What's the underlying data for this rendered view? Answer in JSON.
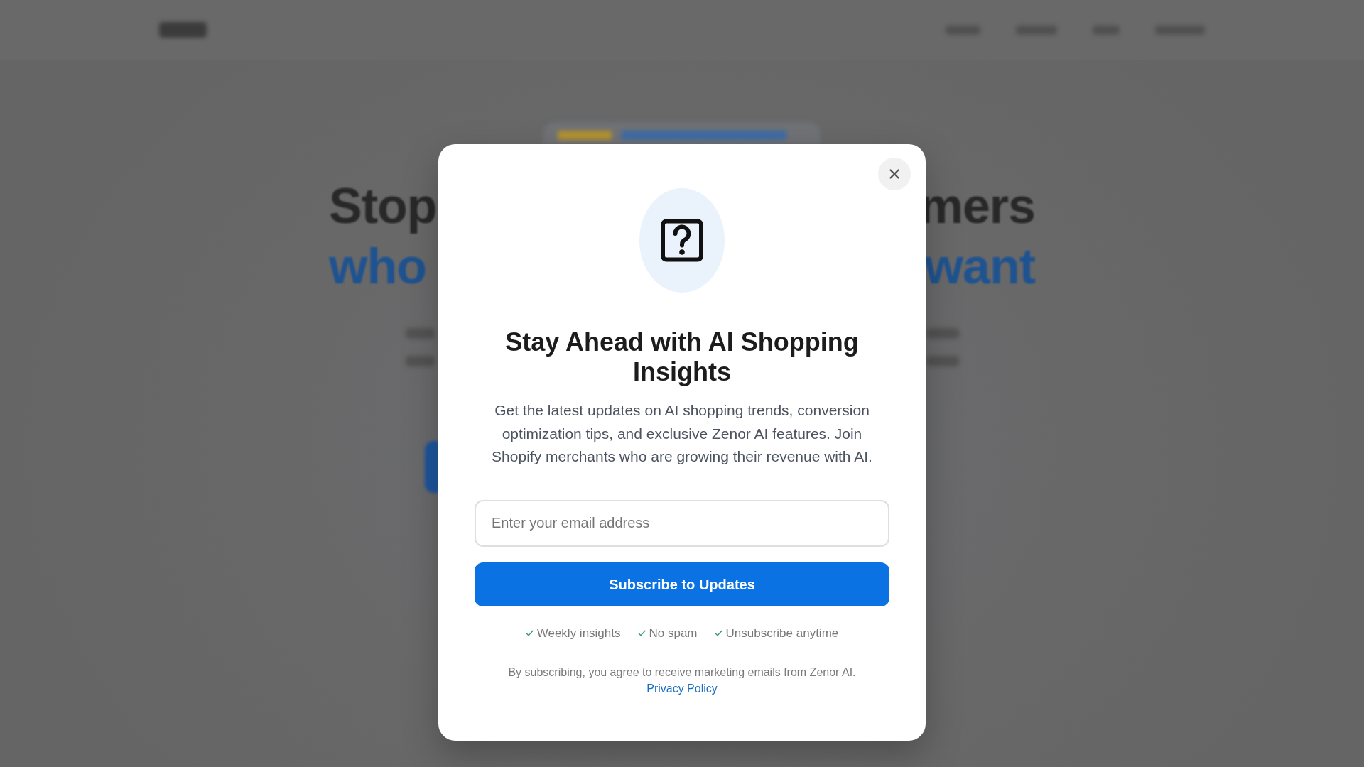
{
  "background_page": {
    "headline": [
      {
        "kind": "plain",
        "left": "Stop",
        "right": "mers"
      },
      {
        "kind": "highlight",
        "left": "who",
        "right": "want"
      }
    ]
  },
  "modal": {
    "title": "Stay Ahead with AI Shopping Insights",
    "description": "Get the latest updates on AI shopping trends, conversion optimization tips, and exclusive Zenor AI features. Join Shopify merchants who are growing their revenue with AI.",
    "email_field": {
      "placeholder": "Enter your email address"
    },
    "subscribe_button": "Subscribe to Updates",
    "benefits": [
      "Weekly insights",
      "No spam",
      "Unsubscribe anytime"
    ],
    "consent": {
      "text": "By subscribing, you agree to receive marketing emails from Zenor AI.",
      "link": "Privacy Policy"
    }
  }
}
